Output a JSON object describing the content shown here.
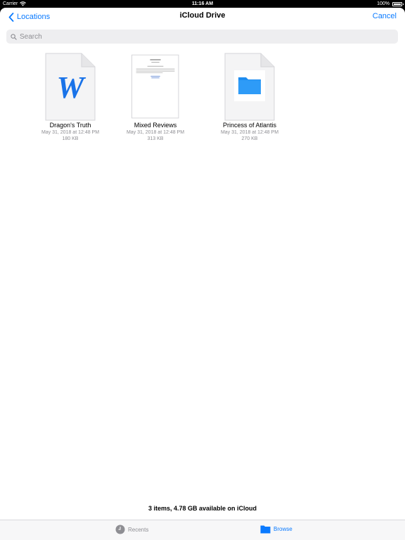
{
  "status_bar": {
    "carrier": "Carrier",
    "time": "11:16 AM",
    "battery": "100%"
  },
  "nav": {
    "back_label": "Locations",
    "title": "iCloud Drive",
    "cancel_label": "Cancel"
  },
  "search": {
    "placeholder": "Search"
  },
  "files": [
    {
      "name": "Dragon's Truth",
      "date": "May 31, 2018 at 12:48 PM",
      "size": "180 KB",
      "thumb": "word-doc-icon"
    },
    {
      "name": "Mixed Reviews",
      "date": "May 31, 2018 at 12:48 PM",
      "size": "313 KB",
      "thumb": "document-preview"
    },
    {
      "name": "Princess of Atlantis",
      "date": "May 31, 2018 at 12:48 PM",
      "size": "270 KB",
      "thumb": "folder-icon"
    }
  ],
  "footer": {
    "info": "3 items, 4.78 GB available on iCloud"
  },
  "tabs": {
    "recents": "Recents",
    "browse": "Browse"
  },
  "colors": {
    "accent": "#0a7aff",
    "secondary_text": "#8e8e93"
  }
}
